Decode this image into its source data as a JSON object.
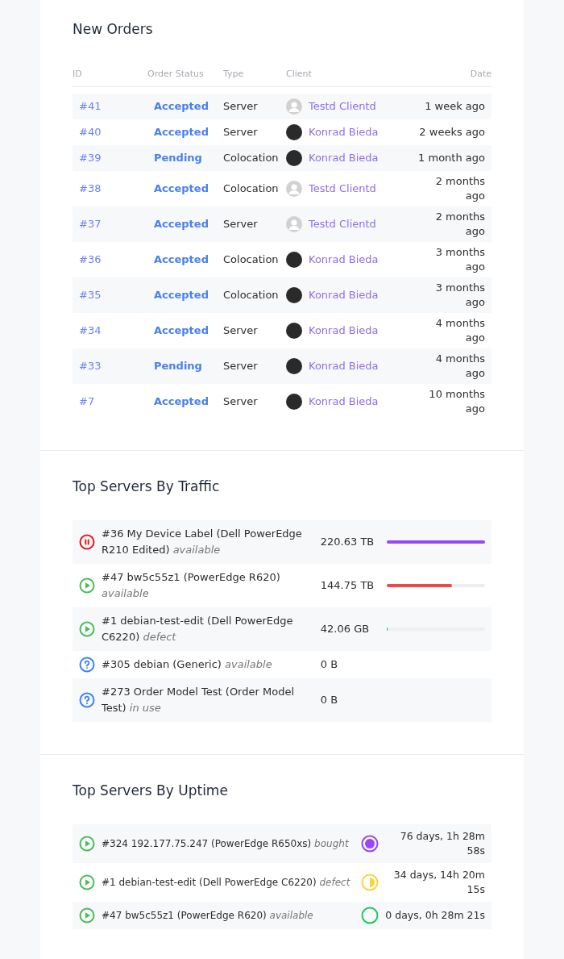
{
  "orders": {
    "title": "New Orders",
    "columns": [
      "ID",
      "Order Status",
      "Type",
      "Client",
      "Date"
    ],
    "rows": [
      {
        "id": "#41",
        "status": "Accepted",
        "type": "Server",
        "kind": "placeholder",
        "client": "Testd Clientd",
        "date": "1 week ago"
      },
      {
        "id": "#40",
        "status": "Accepted",
        "type": "Server",
        "kind": "photo",
        "client": "Konrad Bieda",
        "date": "2 weeks ago"
      },
      {
        "id": "#39",
        "status": "Pending",
        "type": "Colocation",
        "kind": "photo",
        "client": "Konrad Bieda",
        "date": "1 month ago"
      },
      {
        "id": "#38",
        "status": "Accepted",
        "type": "Colocation",
        "kind": "placeholder",
        "client": "Testd Clientd",
        "date": "2 months ago"
      },
      {
        "id": "#37",
        "status": "Accepted",
        "type": "Server",
        "kind": "placeholder",
        "client": "Testd Clientd",
        "date": "2 months ago"
      },
      {
        "id": "#36",
        "status": "Accepted",
        "type": "Colocation",
        "kind": "photo",
        "client": "Konrad Bieda",
        "date": "3 months ago"
      },
      {
        "id": "#35",
        "status": "Accepted",
        "type": "Colocation",
        "kind": "photo",
        "client": "Konrad Bieda",
        "date": "3 months ago"
      },
      {
        "id": "#34",
        "status": "Accepted",
        "type": "Server",
        "kind": "photo",
        "client": "Konrad Bieda",
        "date": "4 months ago"
      },
      {
        "id": "#33",
        "status": "Pending",
        "type": "Server",
        "kind": "photo",
        "client": "Konrad Bieda",
        "date": "4 months ago"
      },
      {
        "id": "#7",
        "status": "Accepted",
        "type": "Server",
        "kind": "photo",
        "client": "Konrad Bieda",
        "date": "10 months ago"
      }
    ]
  },
  "traffic": {
    "title": "Top Servers By Traffic",
    "rows": [
      {
        "kind": "paused",
        "name": "#36 My Device Label (Dell PowerEdge R210 Edited)",
        "state": "available",
        "amount": "220.63 TB",
        "level": 1,
        "color": "#9747f5"
      },
      {
        "kind": "running",
        "name": "#47 bw5c55z1 (PowerEdge R620)",
        "state": "available",
        "amount": "144.75 TB",
        "level": 0.66,
        "color": "#f04848"
      },
      {
        "kind": "running",
        "name": "#1 debian-test-edit (Dell PowerEdge C6220)",
        "state": "defect",
        "amount": "42.06 GB",
        "level": 0.01,
        "color": "#22c55e"
      },
      {
        "kind": "unknown",
        "name": "#305 debian (Generic)",
        "state": "available",
        "amount": "0 B"
      },
      {
        "kind": "unknown",
        "name": "#273 Order Model Test (Order Model Test)",
        "state": "in use",
        "amount": "0 B"
      }
    ]
  },
  "uptime": {
    "title": "Top Servers By Uptime",
    "rows": [
      {
        "name": "#324 192.177.75.247 (PowerEdge R650xs)",
        "state": "bought",
        "kind": "full",
        "color": "#9747f5",
        "uptime": "76 days, 1h 28m 58s"
      },
      {
        "name": "#1 debian-test-edit (Dell PowerEdge C6220)",
        "state": "defect",
        "kind": "half",
        "color": "#f5d63a",
        "uptime": "34 days, 14h 20m 15s"
      },
      {
        "name": "#47 bw5c55z1 (PowerEdge R620)",
        "state": "available",
        "kind": "empty",
        "color": "#22c55e",
        "uptime": "0 days, 0h 28m 21s"
      }
    ]
  }
}
